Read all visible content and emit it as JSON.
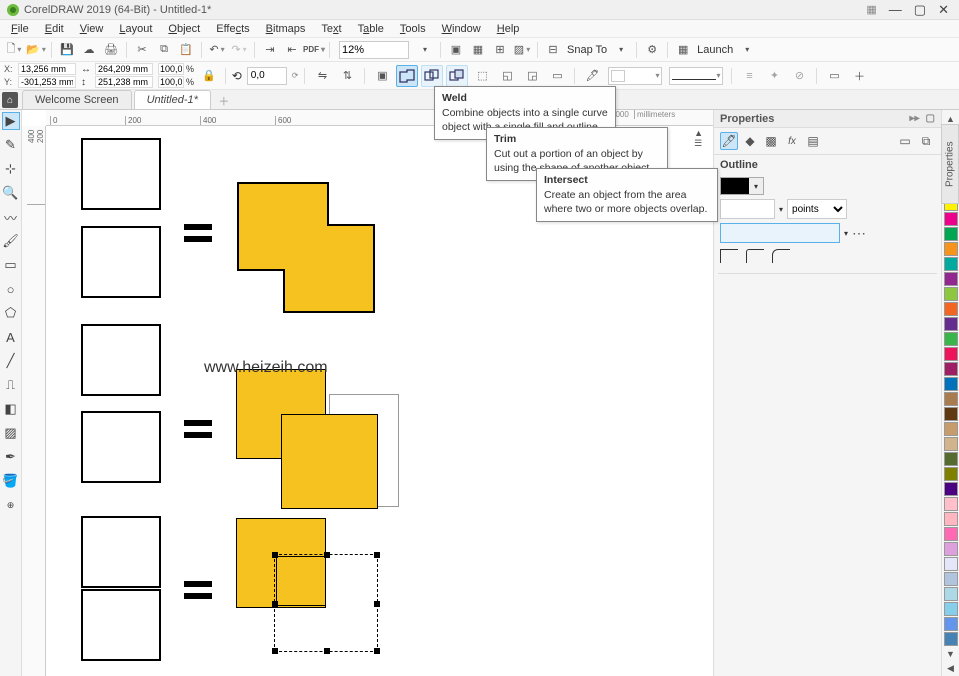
{
  "app": {
    "title": "CorelDRAW 2019 (64-Bit) - Untitled-1*"
  },
  "menu": [
    "File",
    "Edit",
    "View",
    "Layout",
    "Object",
    "Effects",
    "Bitmaps",
    "Text",
    "Table",
    "Tools",
    "Window",
    "Help"
  ],
  "toolbar_main": {
    "zoom": "12%",
    "snap": "Snap To",
    "launch": "Launch"
  },
  "prop_bar": {
    "x_label": "X:",
    "x": "13,256 mm",
    "y_label": "Y:",
    "y": "-301,253 mm",
    "w": "264,209 mm",
    "h": "251,238 mm",
    "sx": "100,0",
    "sy": "100,0",
    "pct": "%",
    "rot": "0,0"
  },
  "tabs": {
    "welcome": "Welcome Screen",
    "active": "Untitled-1*"
  },
  "ruler": {
    "units": "millimeters",
    "ticks_top": [
      "0",
      "200",
      "400",
      "600"
    ],
    "tick_far": "1000",
    "ticks_left": [
      "200",
      "400"
    ]
  },
  "watermark": "www.heizeih.com",
  "tooltips": {
    "weld": {
      "title": "Weld",
      "text": "Combine objects into a single curve object with a single fill and outline."
    },
    "trim": {
      "title": "Trim",
      "text": "Cut out a portion of an object by using the shape of another object."
    },
    "intersect": {
      "title": "Intersect",
      "text": "Create an object from the area where two or more objects overlap."
    }
  },
  "properties": {
    "title": "Properties",
    "outline": "Outline",
    "units": "points"
  },
  "palette": [
    "#000000",
    "#ffffff",
    "#00aeef",
    "#ed1c24",
    "#fff200",
    "#ec008c",
    "#00a651",
    "#f7941d",
    "#00a99d",
    "#92278f",
    "#8dc63f",
    "#f26522",
    "#662d91",
    "#39b54a",
    "#ed145b",
    "#9e1f63",
    "#0072bc",
    "#a97c50",
    "#603913",
    "#c69c6d",
    "#d2b48c",
    "#556b2f",
    "#808000",
    "#4b0082",
    "#ffc0cb",
    "#ffb6c1",
    "#ff69b4",
    "#dda0dd",
    "#e6e6fa",
    "#b0c4de",
    "#add8e6",
    "#87ceeb",
    "#6495ed",
    "#4682b4"
  ]
}
